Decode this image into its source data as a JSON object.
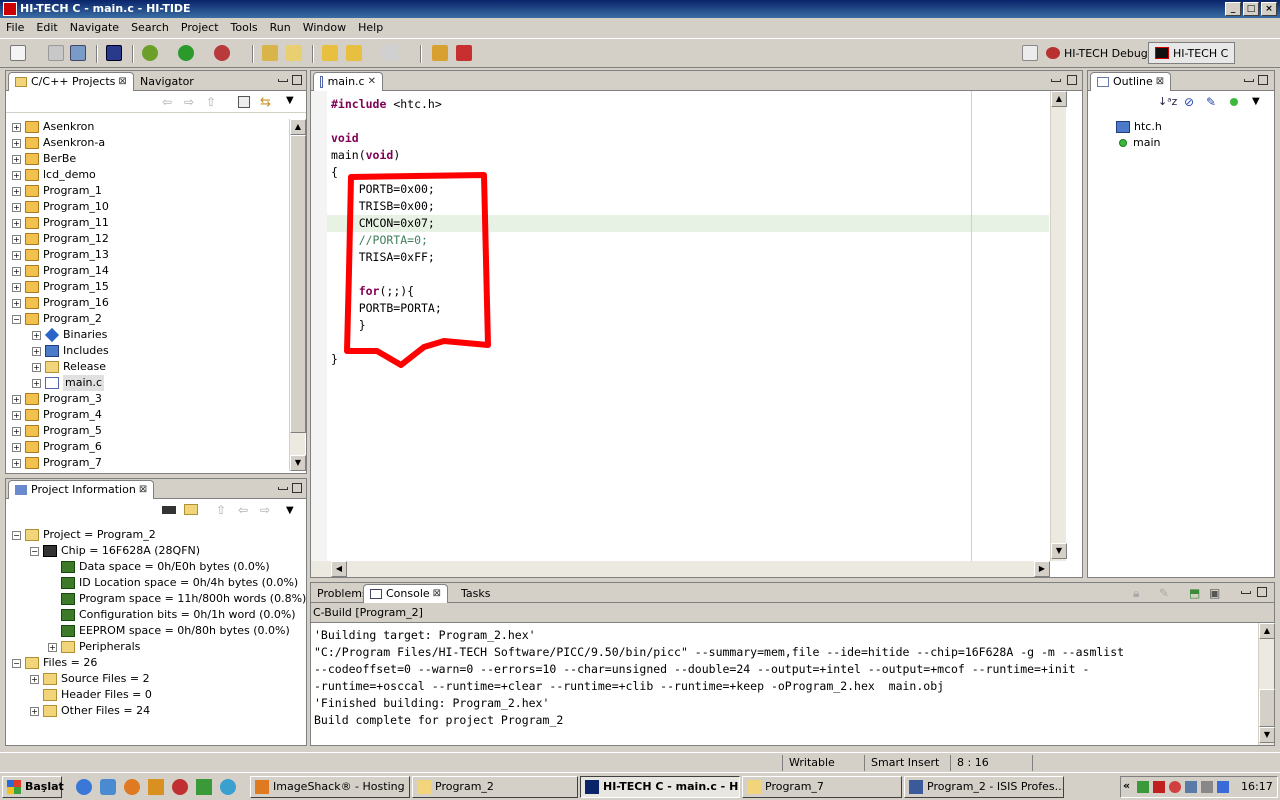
{
  "window": {
    "title": "HI-TECH C - main.c - HI-TIDE"
  },
  "menu": [
    "File",
    "Edit",
    "Navigate",
    "Search",
    "Project",
    "Tools",
    "Run",
    "Window",
    "Help"
  ],
  "perspectives": [
    {
      "label": "HI-TECH Debug"
    },
    {
      "label": "HI-TECH C"
    }
  ],
  "projects_panel": {
    "tabs": [
      {
        "label": "C/C++ Projects"
      },
      {
        "label": "Navigator"
      }
    ],
    "items": [
      {
        "label": "Asenkron",
        "depth": 0
      },
      {
        "label": "Asenkron-a",
        "depth": 0
      },
      {
        "label": "BerBe",
        "depth": 0
      },
      {
        "label": "lcd_demo",
        "depth": 0
      },
      {
        "label": "Program_1",
        "depth": 0
      },
      {
        "label": "Program_10",
        "depth": 0
      },
      {
        "label": "Program_11",
        "depth": 0
      },
      {
        "label": "Program_12",
        "depth": 0
      },
      {
        "label": "Program_13",
        "depth": 0
      },
      {
        "label": "Program_14",
        "depth": 0
      },
      {
        "label": "Program_15",
        "depth": 0
      },
      {
        "label": "Program_16",
        "depth": 0
      },
      {
        "label": "Program_2",
        "depth": 0,
        "expanded": true
      },
      {
        "label": "Binaries",
        "depth": 1
      },
      {
        "label": "Includes",
        "depth": 1
      },
      {
        "label": "Release",
        "depth": 1
      },
      {
        "label": "main.c",
        "depth": 1,
        "selected": true
      },
      {
        "label": "Program_3",
        "depth": 0
      },
      {
        "label": "Program_4",
        "depth": 0
      },
      {
        "label": "Program_5",
        "depth": 0
      },
      {
        "label": "Program_6",
        "depth": 0
      },
      {
        "label": "Program_7",
        "depth": 0
      }
    ]
  },
  "project_info": {
    "tab": "Project Information",
    "items": [
      {
        "label": "Project = Program_2",
        "depth": 0,
        "toggle": "−",
        "icon": "folder"
      },
      {
        "label": "Chip = 16F628A (28QFN)",
        "depth": 1,
        "toggle": "−",
        "icon": "chip"
      },
      {
        "label": "Data space = 0h/E0h bytes (0.0%)",
        "depth": 2,
        "icon": "mem"
      },
      {
        "label": "ID Location space = 0h/4h bytes (0.0%)",
        "depth": 2,
        "icon": "mem"
      },
      {
        "label": "Program space = 11h/800h words (0.8%)",
        "depth": 2,
        "icon": "mem"
      },
      {
        "label": "Configuration bits = 0h/1h word (0.0%)",
        "depth": 2,
        "icon": "mem"
      },
      {
        "label": "EEPROM space = 0h/80h bytes (0.0%)",
        "depth": 2,
        "icon": "mem"
      },
      {
        "label": "Peripherals",
        "depth": 2,
        "toggle": "+",
        "icon": "folder"
      },
      {
        "label": "Files = 26",
        "depth": 0,
        "toggle": "−",
        "icon": "folder"
      },
      {
        "label": "Source Files = 2",
        "depth": 1,
        "toggle": "+",
        "icon": "folder"
      },
      {
        "label": "Header Files = 0",
        "depth": 1,
        "icon": "folder"
      },
      {
        "label": "Other Files = 24",
        "depth": 1,
        "toggle": "+",
        "icon": "folder"
      }
    ]
  },
  "editor": {
    "tab": "main.c",
    "lines": [
      {
        "parts": [
          {
            "t": "#include",
            "c": "pp"
          },
          {
            "t": " <htc.h>",
            "c": ""
          }
        ]
      },
      {
        "parts": [
          {
            "t": "",
            "c": ""
          }
        ]
      },
      {
        "parts": [
          {
            "t": "void",
            "c": "kw"
          }
        ]
      },
      {
        "parts": [
          {
            "t": "main(",
            "c": ""
          },
          {
            "t": "void",
            "c": "kw"
          },
          {
            "t": ")",
            "c": ""
          }
        ]
      },
      {
        "parts": [
          {
            "t": "{",
            "c": ""
          }
        ]
      },
      {
        "parts": [
          {
            "t": "    PORTB=0x00;",
            "c": ""
          }
        ]
      },
      {
        "parts": [
          {
            "t": "    TRISB=0x00;",
            "c": ""
          }
        ]
      },
      {
        "parts": [
          {
            "t": "    CMCON=0x07;",
            "c": ""
          }
        ],
        "highlight": true
      },
      {
        "parts": [
          {
            "t": "    //PORTA=0;",
            "c": "cm"
          }
        ]
      },
      {
        "parts": [
          {
            "t": "    TRISA=0xFF;",
            "c": ""
          }
        ]
      },
      {
        "parts": [
          {
            "t": "",
            "c": ""
          }
        ]
      },
      {
        "parts": [
          {
            "t": "    ",
            "c": ""
          },
          {
            "t": "for",
            "c": "kw"
          },
          {
            "t": "(;;){",
            "c": ""
          }
        ]
      },
      {
        "parts": [
          {
            "t": "    PORTB=PORTA;",
            "c": ""
          }
        ]
      },
      {
        "parts": [
          {
            "t": "    }",
            "c": ""
          }
        ]
      },
      {
        "parts": [
          {
            "t": "",
            "c": ""
          }
        ]
      },
      {
        "parts": [
          {
            "t": "}",
            "c": ""
          }
        ]
      }
    ]
  },
  "outline": {
    "tab": "Outline",
    "items": [
      {
        "label": "htc.h",
        "icon": "header"
      },
      {
        "label": "main",
        "icon": "function"
      }
    ]
  },
  "bottom_panel": {
    "tabs": [
      {
        "label": "Problems"
      },
      {
        "label": "Console"
      },
      {
        "label": "Tasks"
      }
    ],
    "console_title": "C-Build [Program_2]",
    "lines": [
      "'Building target: Program_2.hex'",
      "\"C:/Program Files/HI-TECH Software/PICC/9.50/bin/picc\" --summary=mem,file --ide=hitide --chip=16F628A -g -m --asmlist",
      "--codeoffset=0 --warn=0 --errors=10 --char=unsigned --double=24 --output=+intel --output=+mcof --runtime=+init -",
      "-runtime=+osccal --runtime=+clear --runtime=+clib --runtime=+keep -oProgram_2.hex  main.obj",
      "'Finished building: Program_2.hex'",
      "Build complete for project Program_2"
    ]
  },
  "status": {
    "writable": "Writable",
    "insert": "Smart Insert",
    "position": "8 : 16"
  },
  "taskbar": {
    "start": "Başlat",
    "tasks": [
      {
        "label": "ImageShack® - Hosting ...",
        "active": false
      },
      {
        "label": "Program_2",
        "active": false
      },
      {
        "label": "HI-TECH C - main.c - H...",
        "active": true
      },
      {
        "label": "Program_7",
        "active": false
      },
      {
        "label": "Program_2 - ISIS Profes...",
        "active": false
      }
    ],
    "clock": "16:17",
    "tray_chevron": "«"
  },
  "colors": {
    "annotation": "#ff0000",
    "keyword": "#7f0055",
    "comment": "#3f7f5f",
    "titlebar": "#0a246a"
  }
}
